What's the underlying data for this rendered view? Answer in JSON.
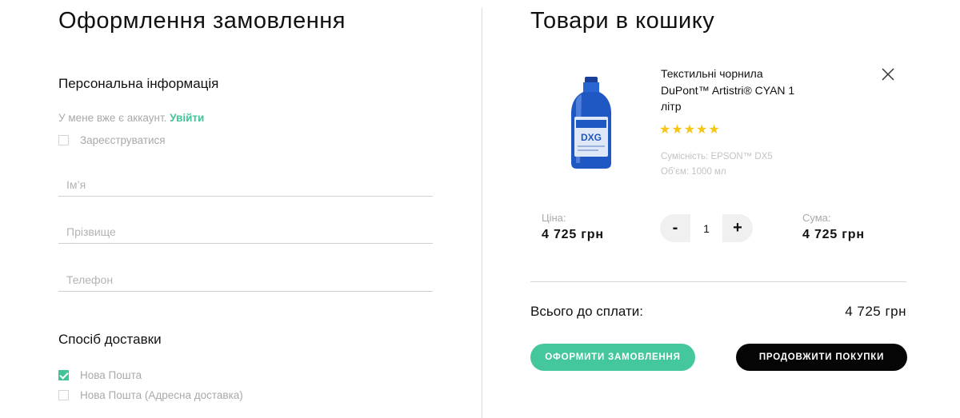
{
  "checkout": {
    "title": "Оформлення замовлення",
    "personal": {
      "heading": "Персональна інформація",
      "account_text": "У мене вже є аккаунт.",
      "login_link": "Увійти",
      "register_label": "Зареєструватися",
      "register_checked": false
    },
    "fields": {
      "name_placeholder": "Ім’я",
      "surname_placeholder": "Прізвище",
      "phone_placeholder": "Телефон"
    },
    "delivery": {
      "heading": "Спосіб доставки",
      "options": [
        {
          "label": "Нова Пошта",
          "checked": true
        },
        {
          "label": "Нова Пошта (Адресна доставка)",
          "checked": false
        }
      ]
    }
  },
  "cart": {
    "title": "Товари в кошику",
    "item": {
      "name": "Текстильні чорнила DuPont™ Artistri® CYAN 1 літр",
      "rating": 5,
      "rating_stars": "★★★★★",
      "compat": "Сумісність: EPSON™ DX5",
      "volume": "Об’єм: 1000 мл",
      "price_label": "Ціна:",
      "price": "4 725 грн",
      "qty_minus": "-",
      "qty": "1",
      "qty_plus": "+",
      "sum_label": "Сума:",
      "sum": "4 725 грн",
      "bottle_label": "DXG",
      "bottle_color": "#1f57c3"
    },
    "total_label": "Всього до сплати:",
    "total_value": "4 725 грн",
    "order_button": "ОФОРМИТИ ЗАМОВЛЕННЯ",
    "continue_button": "ПРОДОВЖИТИ ПОКУПКИ"
  },
  "colors": {
    "accent": "#45c79d",
    "star": "#f5c518",
    "dark_button": "#050505"
  }
}
